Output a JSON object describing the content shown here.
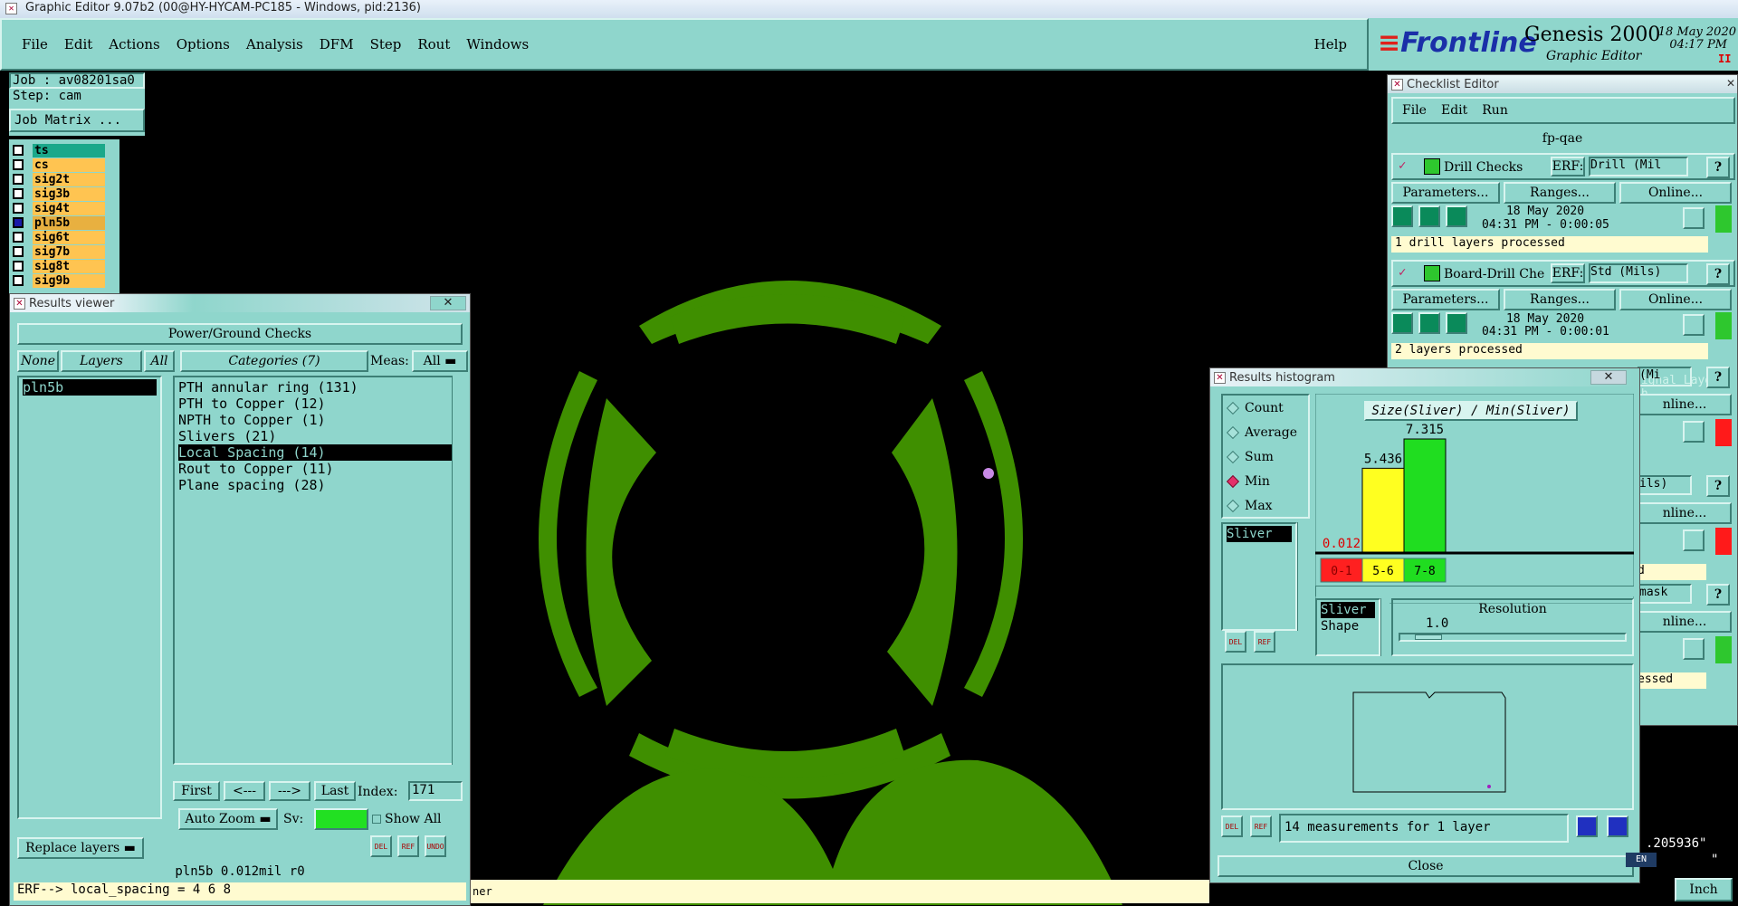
{
  "app": {
    "title": "Graphic Editor 9.07b2 (00@HY-HYCAM-PC185 - Windows, pid:2136)",
    "menu": [
      "File",
      "Edit",
      "Actions",
      "Options",
      "Analysis",
      "DFM",
      "Step",
      "Rout",
      "Windows"
    ],
    "help": "Help",
    "brand": "Frontline",
    "product": "Genesis 2000",
    "product_sub": "Graphic Editor",
    "date": "18 May 2020",
    "time": "04:17 PM",
    "pause": "II"
  },
  "job": {
    "job": "Job : av08201sa0",
    "step": "Step: cam",
    "matrix": "Job Matrix ..."
  },
  "layers": [
    "ts",
    "cs",
    "sig2t",
    "sig3b",
    "sig4t",
    "pln5b",
    "sig6t",
    "sig7b",
    "sig8t",
    "sig9b"
  ],
  "results": {
    "title": "Results viewer",
    "header": "Power/Ground Checks",
    "none": "None",
    "layers_label": "Layers",
    "all": "All",
    "categories_label": "Categories (7)",
    "meas_label": "Meas:",
    "meas_value": "All",
    "layer_items": [
      "pln5b"
    ],
    "categories": [
      "PTH annular ring (131)",
      "PTH to Copper (12)",
      "NPTH to Copper (1)",
      "Slivers (21)",
      "Local Spacing (14)",
      "Rout to Copper (11)",
      "Plane spacing (28)"
    ],
    "nav": {
      "first": "First",
      "prev": "<---",
      "next": "--->",
      "last": "Last",
      "index_label": "Index:",
      "index_value": "171"
    },
    "auto_zoom": "Auto Zoom",
    "sv": "Sv:",
    "show_all": "Show All",
    "replace": "Replace layers",
    "del": "DEL",
    "ref": "REF",
    "undo": "UNDO",
    "status": "pln5b 0.012mil  r0",
    "erf": "ERF--> local_spacing = 4 6 8"
  },
  "checklist": {
    "title": "Checklist Editor",
    "menu": [
      "File",
      "Edit",
      "Run"
    ],
    "name": "fp-qae",
    "checks": [
      {
        "name": "Drill Checks",
        "erf_label": "ERF:",
        "erf": "Drill (Mil",
        "params": "Parameters...",
        "ranges": "Ranges...",
        "online": "Online...",
        "date": "18 May 2020",
        "time": "04:31 PM - 0:00:05",
        "status": "1 drill layers processed"
      },
      {
        "name": "Board-Drill Che",
        "erf_label": "ERF:",
        "erf": "Std (Mils)",
        "params": "Parameters...",
        "ranges": "Ranges...",
        "online": "Online...",
        "date": "18 May 2020",
        "time": "04:31 PM - 0:00:01",
        "status": "2 layers processed"
      }
    ],
    "partials": [
      "(Mi",
      "nline...",
      "ils)",
      "nline...",
      "d",
      "mask",
      "nline...",
      "essed"
    ],
    "signal": "Signal Layer Ch"
  },
  "histogram": {
    "title": "Results histogram",
    "options": [
      "Count",
      "Average",
      "Sum",
      "Min",
      "Max"
    ],
    "selected": "Min",
    "list_item": "Sliver",
    "chart_title": "Size(Sliver) / Min(Sliver)",
    "resolution_label": "Resolution",
    "resolution_value": "1.0",
    "list2": [
      "Sliver",
      "Shape"
    ],
    "measurements": "14 measurements for 1 layer",
    "close": "Close",
    "del": "DEL",
    "ref": "REF"
  },
  "chart_data": {
    "type": "bar",
    "categories": [
      "0-1",
      "5-6",
      "7-8"
    ],
    "values": [
      0.012,
      5.436,
      7.315
    ],
    "title": "Size(Sliver) / Min(Sliver)",
    "ylim": [
      0,
      7.315
    ],
    "colors": [
      "#ff2020",
      "#ffff20",
      "#20dd20"
    ]
  },
  "footer": {
    "ner": "ner",
    "coord": ".205936\"",
    "coord2": "\"",
    "unit": "Inch",
    "lang": "EN"
  },
  "colors": {
    "copper": "#3f8f00",
    "teal": "#8fd6cc",
    "selected_layer": "#1aa88a"
  }
}
